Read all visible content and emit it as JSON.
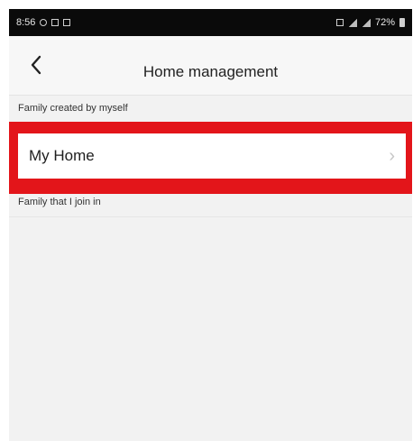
{
  "status_bar": {
    "time": "8:56",
    "battery_text": "72%"
  },
  "header": {
    "title": "Home management",
    "back_icon": "chevron-left-icon"
  },
  "sections": {
    "created": {
      "label": "Family created by myself",
      "items": [
        {
          "label": "My Home",
          "icon": "chevron-right-icon"
        }
      ]
    },
    "joined": {
      "label": "Family that I join in"
    }
  },
  "colors": {
    "highlight": "#e3151a",
    "background": "#f2f2f2",
    "status_bar": "#0a0a0a"
  }
}
